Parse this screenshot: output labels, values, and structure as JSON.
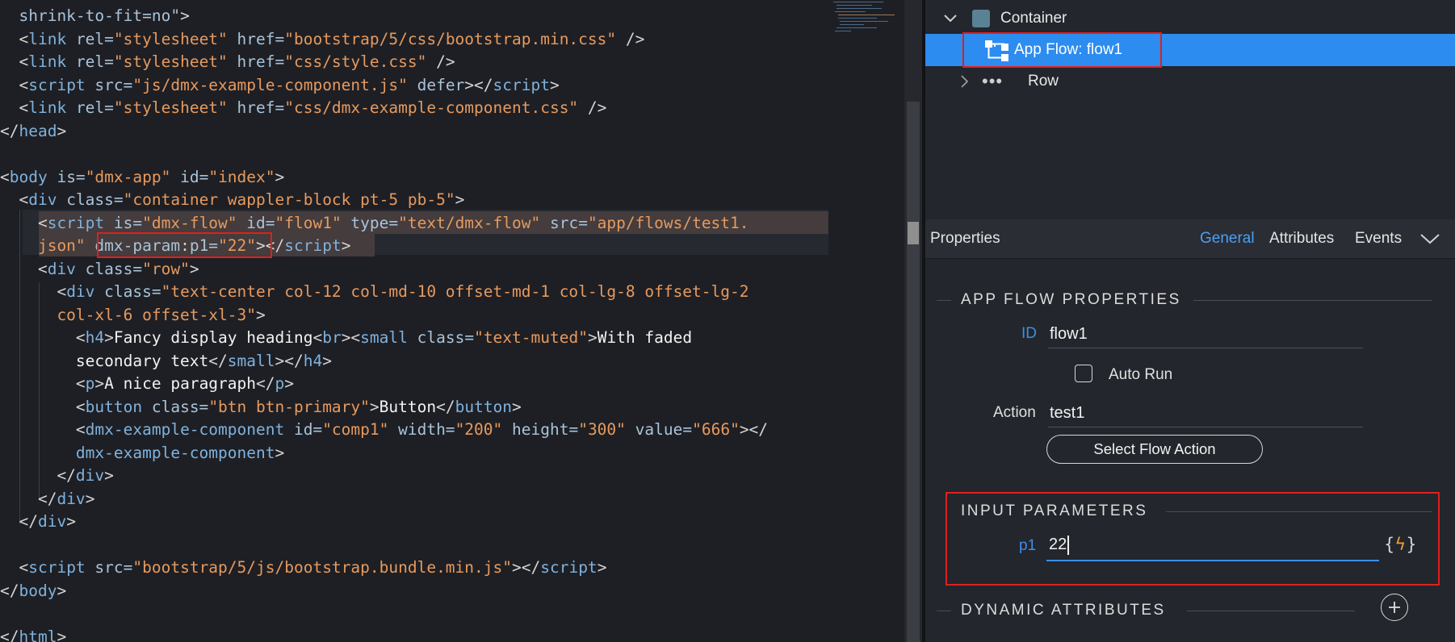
{
  "editor": {
    "lines": [
      [
        {
          "c": "tk-attr",
          "t": "  shrink-to-fit=no\""
        },
        {
          "c": "tk-punct",
          "t": ">"
        }
      ],
      [
        {
          "c": "tk-punct",
          "t": "  <"
        },
        {
          "c": "tk-tag",
          "t": "link "
        },
        {
          "c": "tk-attr",
          "t": "rel="
        },
        {
          "c": "tk-str",
          "t": "\"stylesheet\" "
        },
        {
          "c": "tk-attr",
          "t": "href="
        },
        {
          "c": "tk-str",
          "t": "\"bootstrap/5/css/bootstrap.min.css\""
        },
        {
          "c": "tk-punct",
          "t": " />"
        }
      ],
      [
        {
          "c": "tk-punct",
          "t": "  <"
        },
        {
          "c": "tk-tag",
          "t": "link "
        },
        {
          "c": "tk-attr",
          "t": "rel="
        },
        {
          "c": "tk-str",
          "t": "\"stylesheet\" "
        },
        {
          "c": "tk-attr",
          "t": "href="
        },
        {
          "c": "tk-str",
          "t": "\"css/style.css\""
        },
        {
          "c": "tk-punct",
          "t": " />"
        }
      ],
      [
        {
          "c": "tk-punct",
          "t": "  <"
        },
        {
          "c": "tk-tag",
          "t": "script "
        },
        {
          "c": "tk-attr",
          "t": "src="
        },
        {
          "c": "tk-str",
          "t": "\"js/dmx-example-component.js\" "
        },
        {
          "c": "tk-attr",
          "t": "defer"
        },
        {
          "c": "tk-punct",
          "t": "></"
        },
        {
          "c": "tk-tag",
          "t": "script"
        },
        {
          "c": "tk-punct",
          "t": ">"
        }
      ],
      [
        {
          "c": "tk-punct",
          "t": "  <"
        },
        {
          "c": "tk-tag",
          "t": "link "
        },
        {
          "c": "tk-attr",
          "t": "rel="
        },
        {
          "c": "tk-str",
          "t": "\"stylesheet\" "
        },
        {
          "c": "tk-attr",
          "t": "href="
        },
        {
          "c": "tk-str",
          "t": "\"css/dmx-example-component.css\""
        },
        {
          "c": "tk-punct",
          "t": " />"
        }
      ],
      [
        {
          "c": "tk-punct",
          "t": "</"
        },
        {
          "c": "tk-tag",
          "t": "head"
        },
        {
          "c": "tk-punct",
          "t": ">"
        }
      ],
      [],
      [
        {
          "c": "tk-punct",
          "t": "<"
        },
        {
          "c": "tk-tag",
          "t": "body "
        },
        {
          "c": "tk-attr",
          "t": "is="
        },
        {
          "c": "tk-str",
          "t": "\"dmx-app\" "
        },
        {
          "c": "tk-attr",
          "t": "id="
        },
        {
          "c": "tk-str",
          "t": "\"index\""
        },
        {
          "c": "tk-punct",
          "t": ">"
        }
      ],
      [
        {
          "c": "tk-punct",
          "t": "  <"
        },
        {
          "c": "tk-tag",
          "t": "div "
        },
        {
          "c": "tk-attr",
          "t": "class="
        },
        {
          "c": "tk-str",
          "t": "\"container wappler-block pt-5 pb-5\""
        },
        {
          "c": "tk-punct",
          "t": ">"
        }
      ],
      [
        {
          "c": "tk-punct",
          "t": "    <"
        },
        {
          "c": "tk-tag",
          "t": "script "
        },
        {
          "c": "tk-attr",
          "t": "is="
        },
        {
          "c": "tk-str",
          "t": "\"dmx-flow\" "
        },
        {
          "c": "tk-attr",
          "t": "id="
        },
        {
          "c": "tk-str",
          "t": "\"flow1\" "
        },
        {
          "c": "tk-attr",
          "t": "type="
        },
        {
          "c": "tk-str",
          "t": "\"text/dmx-flow\" "
        },
        {
          "c": "tk-attr",
          "t": "src="
        },
        {
          "c": "tk-str",
          "t": "\"app/flows/test1."
        }
      ],
      [
        {
          "c": "tk-str",
          "t": "    json\" "
        },
        {
          "c": "tk-attr",
          "t": "dmx-param"
        },
        {
          "c": "tk-punct",
          "t": ":"
        },
        {
          "c": "tk-attr",
          "t": "p1="
        },
        {
          "c": "tk-str",
          "t": "\"22\""
        },
        {
          "c": "tk-punct",
          "t": "></"
        },
        {
          "c": "tk-tag",
          "t": "script"
        },
        {
          "c": "tk-punct",
          "t": ">"
        }
      ],
      [
        {
          "c": "tk-punct",
          "t": "    <"
        },
        {
          "c": "tk-tag",
          "t": "div "
        },
        {
          "c": "tk-attr",
          "t": "class="
        },
        {
          "c": "tk-str",
          "t": "\"row\""
        },
        {
          "c": "tk-punct",
          "t": ">"
        }
      ],
      [
        {
          "c": "tk-punct",
          "t": "      <"
        },
        {
          "c": "tk-tag",
          "t": "div "
        },
        {
          "c": "tk-attr",
          "t": "class="
        },
        {
          "c": "tk-str",
          "t": "\"text-center col-12 col-md-10 offset-md-1 col-lg-8 offset-lg-2"
        }
      ],
      [
        {
          "c": "tk-str",
          "t": "      col-xl-6 offset-xl-3\""
        },
        {
          "c": "tk-punct",
          "t": ">"
        }
      ],
      [
        {
          "c": "tk-punct",
          "t": "        <"
        },
        {
          "c": "tk-tag",
          "t": "h4"
        },
        {
          "c": "tk-punct",
          "t": ">"
        },
        {
          "c": "tk-text",
          "t": "Fancy display heading"
        },
        {
          "c": "tk-punct",
          "t": "<"
        },
        {
          "c": "tk-tag",
          "t": "br"
        },
        {
          "c": "tk-punct",
          "t": "><"
        },
        {
          "c": "tk-tag",
          "t": "small "
        },
        {
          "c": "tk-attr",
          "t": "class="
        },
        {
          "c": "tk-str",
          "t": "\"text-muted\""
        },
        {
          "c": "tk-punct",
          "t": ">"
        },
        {
          "c": "tk-text",
          "t": "With faded"
        }
      ],
      [
        {
          "c": "tk-text",
          "t": "        secondary text"
        },
        {
          "c": "tk-punct",
          "t": "</"
        },
        {
          "c": "tk-tag",
          "t": "small"
        },
        {
          "c": "tk-punct",
          "t": "></"
        },
        {
          "c": "tk-tag",
          "t": "h4"
        },
        {
          "c": "tk-punct",
          "t": ">"
        }
      ],
      [
        {
          "c": "tk-punct",
          "t": "        <"
        },
        {
          "c": "tk-tag",
          "t": "p"
        },
        {
          "c": "tk-punct",
          "t": ">"
        },
        {
          "c": "tk-text",
          "t": "A nice paragraph"
        },
        {
          "c": "tk-punct",
          "t": "</"
        },
        {
          "c": "tk-tag",
          "t": "p"
        },
        {
          "c": "tk-punct",
          "t": ">"
        }
      ],
      [
        {
          "c": "tk-punct",
          "t": "        <"
        },
        {
          "c": "tk-tag",
          "t": "button "
        },
        {
          "c": "tk-attr",
          "t": "class="
        },
        {
          "c": "tk-str",
          "t": "\"btn btn-primary\""
        },
        {
          "c": "tk-punct",
          "t": ">"
        },
        {
          "c": "tk-text",
          "t": "Button"
        },
        {
          "c": "tk-punct",
          "t": "</"
        },
        {
          "c": "tk-tag",
          "t": "button"
        },
        {
          "c": "tk-punct",
          "t": ">"
        }
      ],
      [
        {
          "c": "tk-punct",
          "t": "        <"
        },
        {
          "c": "tk-tag",
          "t": "dmx-example-component "
        },
        {
          "c": "tk-attr",
          "t": "id="
        },
        {
          "c": "tk-str",
          "t": "\"comp1\" "
        },
        {
          "c": "tk-attr",
          "t": "width="
        },
        {
          "c": "tk-str",
          "t": "\"200\" "
        },
        {
          "c": "tk-attr",
          "t": "height="
        },
        {
          "c": "tk-str",
          "t": "\"300\" "
        },
        {
          "c": "tk-attr",
          "t": "value="
        },
        {
          "c": "tk-str",
          "t": "\"666\""
        },
        {
          "c": "tk-punct",
          "t": "></"
        }
      ],
      [
        {
          "c": "tk-tag",
          "t": "        dmx-example-component"
        },
        {
          "c": "tk-punct",
          "t": ">"
        }
      ],
      [
        {
          "c": "tk-punct",
          "t": "      </"
        },
        {
          "c": "tk-tag",
          "t": "div"
        },
        {
          "c": "tk-punct",
          "t": ">"
        }
      ],
      [
        {
          "c": "tk-punct",
          "t": "    </"
        },
        {
          "c": "tk-tag",
          "t": "div"
        },
        {
          "c": "tk-punct",
          "t": ">"
        }
      ],
      [
        {
          "c": "tk-punct",
          "t": "  </"
        },
        {
          "c": "tk-tag",
          "t": "div"
        },
        {
          "c": "tk-punct",
          "t": ">"
        }
      ],
      [],
      [
        {
          "c": "tk-punct",
          "t": "  <"
        },
        {
          "c": "tk-tag",
          "t": "script "
        },
        {
          "c": "tk-attr",
          "t": "src="
        },
        {
          "c": "tk-str",
          "t": "\"bootstrap/5/js/bootstrap.bundle.min.js\""
        },
        {
          "c": "tk-punct",
          "t": "></"
        },
        {
          "c": "tk-tag",
          "t": "script"
        },
        {
          "c": "tk-punct",
          "t": ">"
        }
      ],
      [
        {
          "c": "tk-punct",
          "t": "</"
        },
        {
          "c": "tk-tag",
          "t": "body"
        },
        {
          "c": "tk-punct",
          "t": ">"
        }
      ],
      [],
      [
        {
          "c": "tk-punct",
          "t": "</"
        },
        {
          "c": "tk-tag",
          "t": "html"
        },
        {
          "c": "tk-punct",
          "t": ">"
        }
      ]
    ]
  },
  "tree": {
    "container_label": "Container",
    "flow_label": "App Flow: flow1",
    "row_label": "Row"
  },
  "properties": {
    "title": "Properties",
    "tabs": [
      "General",
      "Attributes",
      "Events"
    ],
    "active_tab": "General",
    "app_flow_section": "APP FLOW PROPERTIES",
    "id_label": "ID",
    "id_value": "flow1",
    "auto_run_label": "Auto Run",
    "auto_run_checked": false,
    "action_label": "Action",
    "action_value": "test1",
    "select_flow_action": "Select Flow Action",
    "input_params_section": "INPUT PARAMETERS",
    "param_label": "p1",
    "param_value": "22",
    "dynamic_attrs_section": "DYNAMIC ATTRIBUTES"
  },
  "colors": {
    "accent": "#2c8cf0",
    "highlight_box": "#e01f1f",
    "dynamic_icon": "#f0a030"
  }
}
